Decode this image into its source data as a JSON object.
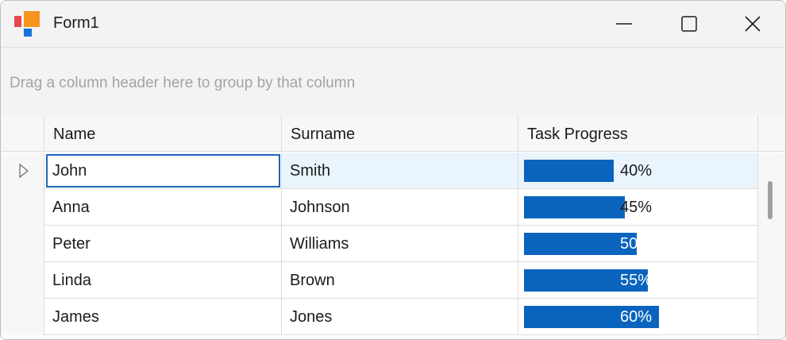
{
  "window": {
    "title": "Form1",
    "controls": [
      "minimize",
      "maximize",
      "close"
    ]
  },
  "groupPanel": {
    "text": "Drag a column header here to group by that column"
  },
  "grid": {
    "columns": [
      "Name",
      "Surname",
      "Task Progress"
    ],
    "rows": [
      {
        "name": "John",
        "surname": "Smith",
        "progress": 40,
        "progress_label": "40%",
        "selected": true
      },
      {
        "name": "Anna",
        "surname": "Johnson",
        "progress": 45,
        "progress_label": "45%"
      },
      {
        "name": "Peter",
        "surname": "Williams",
        "progress": 50,
        "progress_label": "50%"
      },
      {
        "name": "Linda",
        "surname": "Brown",
        "progress": 55,
        "progress_label": "55%"
      },
      {
        "name": "James",
        "surname": "Jones",
        "progress": 60,
        "progress_label": "60%"
      }
    ]
  },
  "colors": {
    "progress_fill": "#0a64be",
    "selected_row": "#eaf4fd",
    "focus_border": "#1f65b8"
  }
}
